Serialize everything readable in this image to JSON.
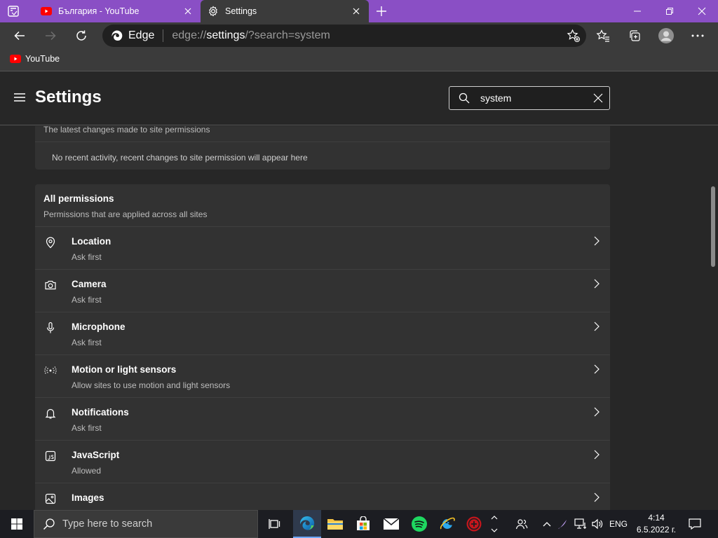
{
  "tabs": [
    {
      "title": "България - YouTube"
    },
    {
      "title": "Settings"
    }
  ],
  "address": {
    "brand": "Edge",
    "url_prefix": "edge://",
    "url_bold": "settings",
    "url_suffix": "/?search=system"
  },
  "favorites": [
    {
      "label": "YouTube"
    }
  ],
  "settings": {
    "title": "Settings",
    "search_value": "system"
  },
  "recent": {
    "description": "The latest changes made to site permissions",
    "empty_text": "No recent activity, recent changes to site permission will appear here"
  },
  "all_permissions": {
    "title": "All permissions",
    "description": "Permissions that are applied across all sites",
    "items": [
      {
        "title": "Location",
        "subtitle": "Ask first",
        "icon": "location-pin-icon"
      },
      {
        "title": "Camera",
        "subtitle": "Ask first",
        "icon": "camera-icon"
      },
      {
        "title": "Microphone",
        "subtitle": "Ask first",
        "icon": "microphone-icon"
      },
      {
        "title": "Motion or light sensors",
        "subtitle": "Allow sites to use motion and light sensors",
        "icon": "sensor-icon"
      },
      {
        "title": "Notifications",
        "subtitle": "Ask first",
        "icon": "bell-icon"
      },
      {
        "title": "JavaScript",
        "subtitle": "Allowed",
        "icon": "javascript-icon"
      },
      {
        "title": "Images",
        "subtitle": "",
        "icon": "image-icon"
      }
    ]
  },
  "taskbar": {
    "search_placeholder": "Type here to search",
    "language": "ENG",
    "time": "4:14",
    "date": "6.5.2022 г."
  },
  "colors": {
    "tab_strip": "#8a4fc5",
    "toolbar": "#3b3b3b",
    "page_bg": "#272727",
    "card_bg": "#323232",
    "youtube_red": "#ff0000",
    "taskbar": "#1c1d22"
  }
}
